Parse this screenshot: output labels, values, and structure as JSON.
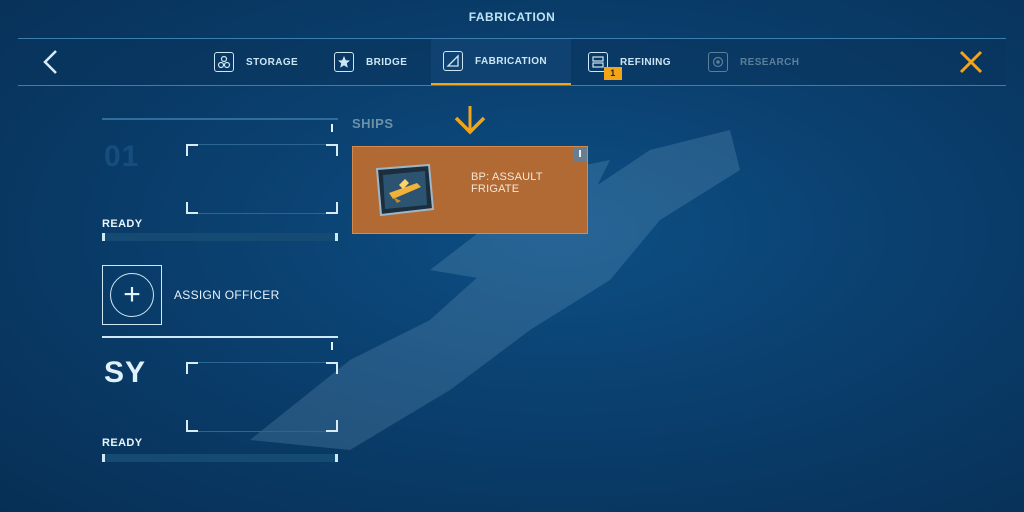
{
  "header": {
    "title": "FABRICATION"
  },
  "nav": {
    "tabs": [
      {
        "label": "STORAGE",
        "icon": "storage-icon",
        "state": "normal"
      },
      {
        "label": "BRIDGE",
        "icon": "star-icon",
        "state": "normal"
      },
      {
        "label": "FABRICATION",
        "icon": "fabrication-icon",
        "state": "active"
      },
      {
        "label": "REFINING",
        "icon": "refining-icon",
        "state": "normal",
        "badge": "1"
      },
      {
        "label": "RESEARCH",
        "icon": "research-icon",
        "state": "disabled"
      }
    ]
  },
  "slots": [
    {
      "id": "01",
      "status": "READY"
    },
    {
      "id": "SY",
      "status": "READY"
    }
  ],
  "assign_officer": {
    "label": "ASSIGN OFFICER"
  },
  "ships_section": {
    "label": "SHIPS",
    "blueprint": {
      "name_line1": "BP: ASSAULT",
      "name_line2": "FRIGATE"
    }
  },
  "colors": {
    "accent": "#f4a418",
    "card": "#b26a35",
    "background": "#0a3f6e"
  }
}
